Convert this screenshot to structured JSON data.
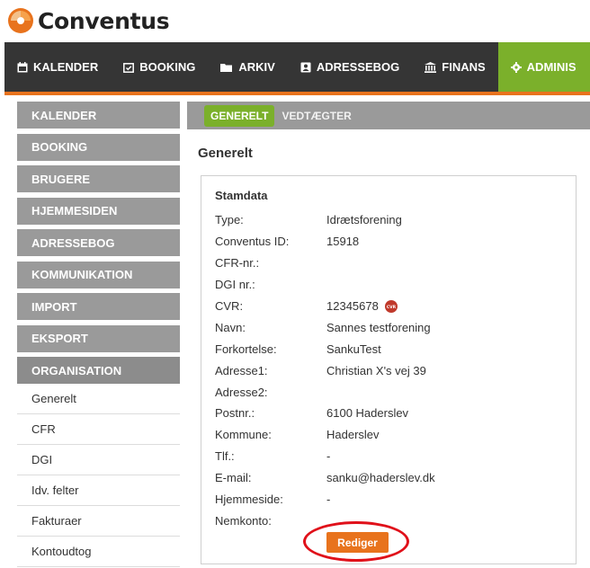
{
  "brand": {
    "name": "Conventus",
    "accent": "#e8731d",
    "green": "#7bb02b"
  },
  "topnav": {
    "items": [
      {
        "label": "KALENDER",
        "icon": "calendar-icon"
      },
      {
        "label": "BOOKING",
        "icon": "calendar-check-icon"
      },
      {
        "label": "ARKIV",
        "icon": "folder-icon"
      },
      {
        "label": "ADRESSEBOG",
        "icon": "address-book-icon"
      },
      {
        "label": "FINANS",
        "icon": "bank-icon"
      },
      {
        "label": "ADMINIS",
        "icon": "gear-icon",
        "active": true
      }
    ]
  },
  "sidebar": {
    "sections": [
      "KALENDER",
      "BOOKING",
      "BRUGERE",
      "HJEMMESIDEN",
      "ADRESSEBOG",
      "KOMMUNIKATION",
      "IMPORT",
      "EKSPORT",
      "ORGANISATION"
    ],
    "subitems": [
      "Generelt",
      "CFR",
      "DGI",
      "Idv. felter",
      "Fakturaer",
      "Kontoudtog"
    ]
  },
  "subtabs": {
    "active": "GENERELT",
    "inactive": "VEDTÆGTER"
  },
  "page": {
    "title": "Generelt"
  },
  "stamdata": {
    "title": "Stamdata",
    "rows": [
      {
        "label": "Type:",
        "value": "Idrætsforening"
      },
      {
        "label": "Conventus ID:",
        "value": "15918"
      },
      {
        "label": "CFR-nr.:",
        "value": ""
      },
      {
        "label": "DGI nr.:",
        "value": ""
      },
      {
        "label": "CVR:",
        "value": "12345678"
      },
      {
        "label": "Navn:",
        "value": "Sannes testforening"
      },
      {
        "label": "Forkortelse:",
        "value": "SankuTest"
      },
      {
        "label": "Adresse1:",
        "value": "Christian X's vej 39"
      },
      {
        "label": "Adresse2:",
        "value": ""
      },
      {
        "label": "Postnr.:",
        "value": "6100 Haderslev"
      },
      {
        "label": "Kommune:",
        "value": "Haderslev"
      },
      {
        "label": "Tlf.:",
        "value": "-"
      },
      {
        "label": "E-mail:",
        "value": "sanku@haderslev.dk"
      },
      {
        "label": "Hjemmeside:",
        "value": "-"
      },
      {
        "label": "Nemkonto:",
        "value": ""
      }
    ],
    "cvr_badge": "CVR"
  },
  "actions": {
    "edit_label": "Rediger"
  }
}
